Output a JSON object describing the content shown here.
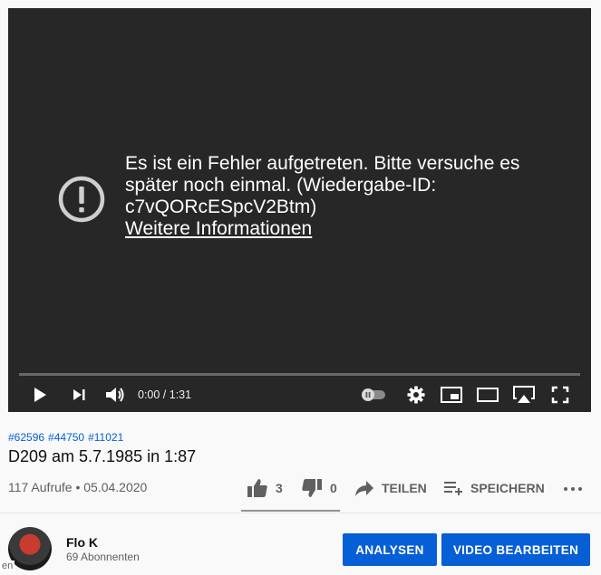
{
  "player": {
    "error_message": "Es ist ein Fehler aufgetreten. Bitte versuche es später noch einmal. (Wiedergabe-ID: c7vQORcESpcV2Btm)",
    "error_link": "Weitere Informationen",
    "time_display": "0:00 / 1:31",
    "progress": 0,
    "icons": [
      "alert-icon",
      "play-icon",
      "next-icon",
      "volume-icon",
      "autoplay-toggle-icon",
      "settings-icon",
      "miniplayer-icon",
      "theater-icon",
      "airplay-icon",
      "fullscreen-icon"
    ]
  },
  "video": {
    "hashtags": [
      "#62596",
      "#44750",
      "#11021"
    ],
    "title": "D209 am 5.7.1985 in 1:87",
    "meta": "117 Aufrufe • 05.04.2020"
  },
  "actions": {
    "likes": "3",
    "dislikes": "0",
    "share": "TEILEN",
    "save": "SPEICHERN",
    "icons": [
      "thumbs-up-icon",
      "thumbs-down-icon",
      "share-icon",
      "add-to-playlist-icon",
      "more-icon"
    ]
  },
  "channel": {
    "name": "Flo K",
    "subscribers": "69 Abonnenten",
    "avatar_label_fragment": "en"
  },
  "buttons": {
    "analytics": "ANALYSEN",
    "edit_video": "VIDEO BEARBEITEN"
  },
  "colors": {
    "accent": "#065fd4",
    "player_bg": "#272727",
    "page_bg": "#f9f9f9",
    "progress": "#ff0000"
  }
}
